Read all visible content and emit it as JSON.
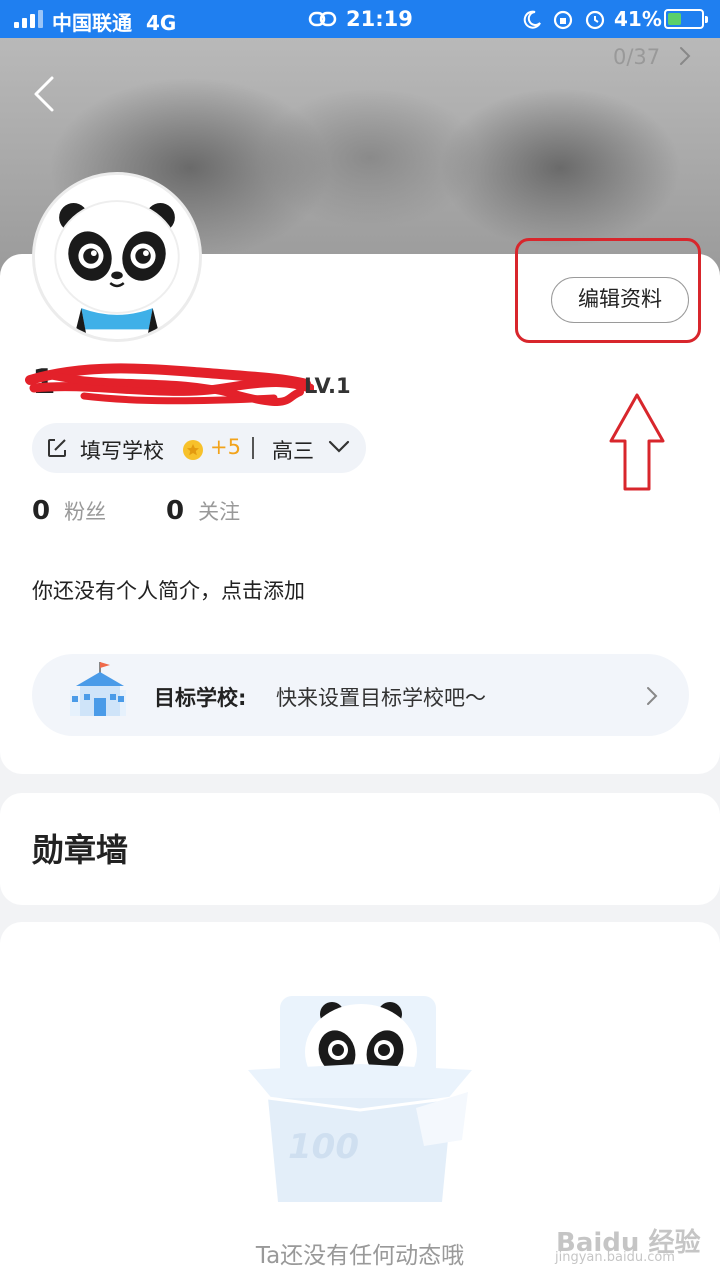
{
  "status_bar": {
    "carrier": "中国联通",
    "network": "4G",
    "time": "21:19",
    "battery": "41%",
    "battery_level": 0.41
  },
  "profile": {
    "level": "LV.1",
    "edit_button": "编辑资料",
    "school_placeholder": "填写学校",
    "school_reward": "+5",
    "grade": "高三",
    "stats": [
      {
        "count": "0",
        "label": "粉丝"
      },
      {
        "count": "0",
        "label": "关注"
      }
    ],
    "bio": "你还没有个人简介，点击添加",
    "target_school": {
      "label": "目标学校:",
      "value": "快来设置目标学校吧～"
    }
  },
  "badge_wall": {
    "title": "勋章墙",
    "count": "0/37"
  },
  "empty_state": {
    "text": "Ta还没有任何动态哦"
  },
  "watermark": {
    "brand": "Baidu 经验",
    "url": "jingyan.baidu.com"
  },
  "colors": {
    "status_bar": "#1f7ff0",
    "annotation_red": "#d8262c",
    "reward_orange": "#f2a31b"
  }
}
